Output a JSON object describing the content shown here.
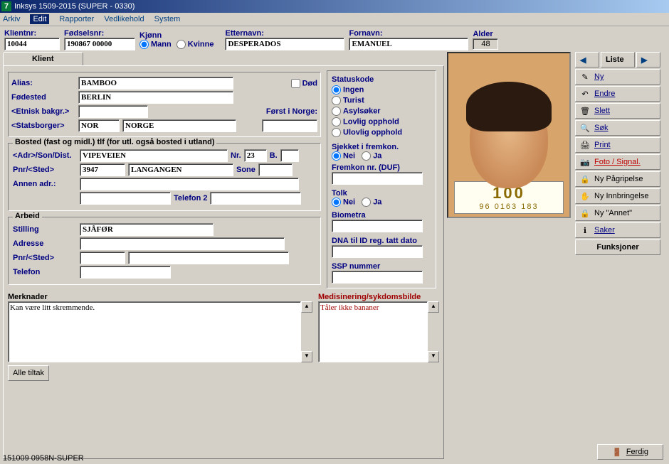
{
  "title": "Inksys 1509-2015  (SUPER - 0330)",
  "menu": {
    "arkiv": "Arkiv",
    "edit": "Edit",
    "rapporter": "Rapporter",
    "vedlikehold": "Vedlikehold",
    "system": "System"
  },
  "top": {
    "klientnr_label": "Klientnr:",
    "klientnr": "10044",
    "fodselsnr_label": "Fødselsnr:",
    "fodselsnr": "190867 00000",
    "kjonn_label": "Kjønn",
    "mann": "Mann",
    "kvinne": "Kvinne",
    "etternavn_label": "Etternavn:",
    "etternavn": "DESPERADOS",
    "fornavn_label": "Fornavn:",
    "fornavn": "EMANUEL",
    "alder_label": "Alder",
    "alder": "48"
  },
  "tab": {
    "klient": "Klient"
  },
  "klient": {
    "alias_label": "Alias:",
    "alias": "BAMBOO",
    "fodested_label": "Fødested",
    "fodested": "BERLIN",
    "etnisk_label": "<Etnisk bakgr.>",
    "etnisk": "",
    "statsborger_label": "<Statsborger>",
    "statsborger_code": "NOR",
    "statsborger_name": "NORGE",
    "dod_label": "Død",
    "forst_label": "Først i Norge:",
    "forst": ""
  },
  "bosted": {
    "legend": "Bosted (fast og midl.) tlf (for utl. også bosted i utland)",
    "adr_label": "<Adr>/Son/Dist.",
    "adr": "VIPEVEIEN",
    "nr_label": "Nr.",
    "nr": "23",
    "b_label": "B.",
    "b": "",
    "pnr_label": "Pnr/<Sted>",
    "pnr": "3947",
    "sted": "LANGANGEN",
    "sone_label": "Sone",
    "sone": "",
    "annen_label": "Annen adr.:",
    "annen1": "",
    "annen2": "",
    "telefon2_label": "Telefon 2",
    "telefon2": ""
  },
  "arbeid": {
    "legend": "Arbeid",
    "stilling_label": "Stilling",
    "stilling": "SJÅFØR",
    "adresse_label": "Adresse",
    "adresse": "",
    "pnr_label": "Pnr/<Sted>",
    "pnr": "",
    "sted": "",
    "telefon_label": "Telefon",
    "telefon": ""
  },
  "status": {
    "legend": "Statuskode",
    "ingen": "Ingen",
    "turist": "Turist",
    "asyl": "Asylsøker",
    "lovlig": "Lovlig opphold",
    "ulovlig": "Ulovlig opphold",
    "sjekket_label": "Sjekket i fremkon.",
    "nei": "Nei",
    "ja": "Ja",
    "fremkon_label": "Fremkon nr.  (DUF)",
    "fremkon": "",
    "tolk_label": "Tolk",
    "biometra_label": "Biometra",
    "biometra": "",
    "dna_label": "DNA til ID reg. tatt dato",
    "dna": "",
    "ssp_label": "SSP nummer",
    "ssp": ""
  },
  "merk": {
    "merknader_label": "Merknader",
    "merknader": "Kan være litt skremmende.",
    "med_label": "Medisinering/sykdomsbilde",
    "med": "Tåler ikke bananer",
    "alle_tiltak": "Alle tiltak"
  },
  "photo": {
    "big": "100",
    "small": "96  0163  183"
  },
  "nav": {
    "liste": "Liste"
  },
  "buttons": {
    "ny": "Ny",
    "endre": "Endre",
    "slett": "Slett",
    "sok": "Søk",
    "print": "Print",
    "foto": "Foto / Signal.",
    "pagrip": "Ny Pågripelse",
    "innbring": "Ny Innbringelse",
    "annet": "Ny \"Annet\"",
    "saker": "Saker",
    "funksjoner": "Funksjoner",
    "ferdig": "Ferdig"
  },
  "footer": "151009 0958N-SUPER"
}
